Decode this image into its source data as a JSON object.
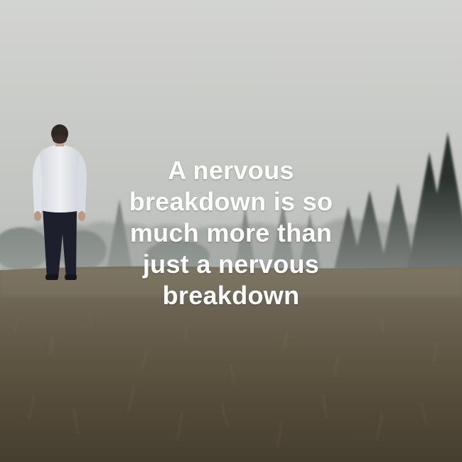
{
  "quote": {
    "lines": [
      "A nervous",
      "breakdown is so",
      "much more than",
      "just a nervous",
      "breakdown"
    ]
  },
  "colors": {
    "sky_top": "#d2d3d0",
    "sky_bottom": "#a9ada9",
    "trees_far": "#8e948f",
    "trees_near": "#2f3733",
    "grass_far": "#6f6a58",
    "grass_near": "#4a4232",
    "shirt": "#e6e8ec",
    "trousers": "#1c1f2b",
    "text": "#ffffff"
  }
}
